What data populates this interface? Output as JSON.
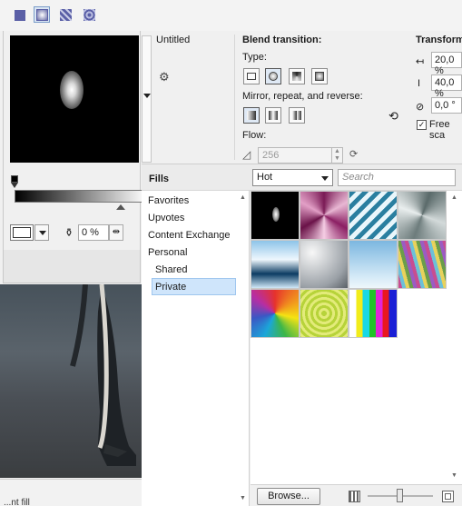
{
  "toolbar": {
    "buttons": [
      "flat-fill",
      "fountain-fill",
      "pattern-fill",
      "texture-fill"
    ]
  },
  "preview": {
    "title": "Untitled"
  },
  "transparency": {
    "value": "0 %"
  },
  "blend": {
    "title": "Blend transition:",
    "type_label": "Type:",
    "mirror_label": "Mirror, repeat, and reverse:",
    "flow_label": "Flow:",
    "flow_value": "256"
  },
  "transform": {
    "title": "Transform",
    "width": "20,0 %",
    "height": "40,0 %",
    "angle": "0,0 °",
    "free_scale_label": "Free sca",
    "free_scale_checked": true
  },
  "fills": {
    "title": "Fills",
    "filter": "Hot",
    "search_placeholder": "Search",
    "nav": [
      "Favorites",
      "Upvotes",
      "Content Exchange",
      "Personal",
      "Shared",
      "Private"
    ],
    "selected": "Private",
    "browse_label": "Browse...",
    "thumbnails": [
      "radial-black",
      "conical-magenta",
      "linear-stripes-cyan",
      "conical-silver",
      "linear-blue-horizon",
      "radial-silver",
      "linear-sky-blue",
      "linear-rainbow-diagonal",
      "conical-rainbow",
      "concentric-green",
      "linear-color-bars"
    ]
  },
  "status": {
    "text": "...nt fill"
  }
}
